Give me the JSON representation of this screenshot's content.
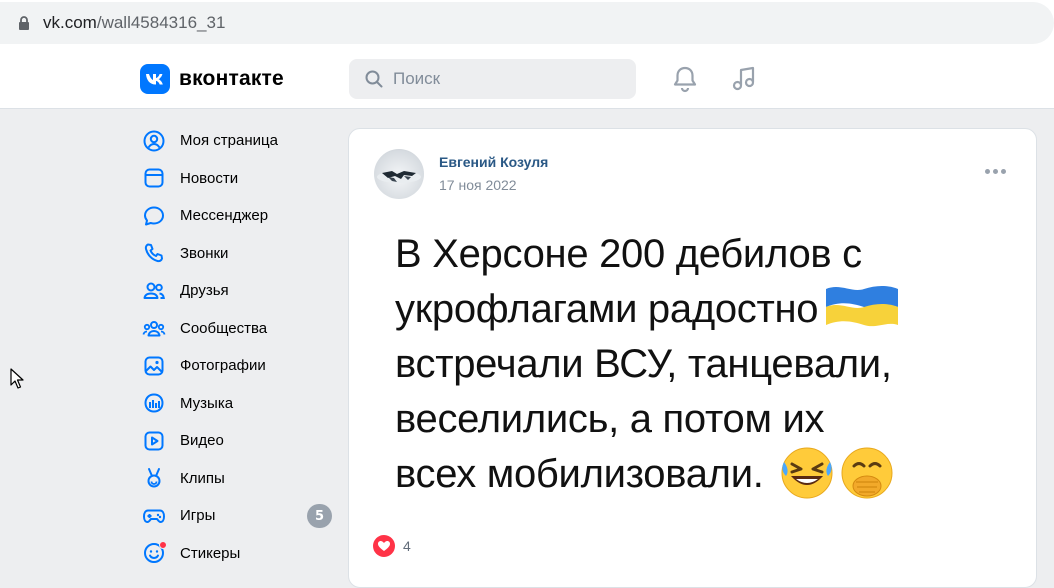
{
  "browser": {
    "url_domain": "vk.com",
    "url_path": "/wall4584316_31"
  },
  "header": {
    "logo_text": "вконтакте",
    "search_placeholder": "Поиск"
  },
  "sidebar": {
    "items": [
      {
        "label": "Моя страница",
        "icon": "user-circle-icon"
      },
      {
        "label": "Новости",
        "icon": "newsfeed-icon"
      },
      {
        "label": "Мессенджер",
        "icon": "message-icon"
      },
      {
        "label": "Звонки",
        "icon": "phone-icon"
      },
      {
        "label": "Друзья",
        "icon": "users-icon"
      },
      {
        "label": "Сообщества",
        "icon": "groups-icon"
      },
      {
        "label": "Фотографии",
        "icon": "photo-icon"
      },
      {
        "label": "Музыка",
        "icon": "music-icon"
      },
      {
        "label": "Видео",
        "icon": "video-icon"
      },
      {
        "label": "Клипы",
        "icon": "clips-icon"
      },
      {
        "label": "Игры",
        "icon": "game-icon",
        "badge": "5"
      },
      {
        "label": "Стикеры",
        "icon": "sticker-icon"
      }
    ]
  },
  "post": {
    "author": "Евгений Козуля",
    "date": "17 ноя 2022",
    "lines": [
      "В Херсоне 200 дебилов с",
      "укрофлагами радостно",
      "встречали ВСУ, танцевали,",
      "веселились, а потом их",
      "всех мобилизовали."
    ],
    "likes": "4"
  },
  "colors": {
    "accent": "#0077ff",
    "link": "#2a5885",
    "badge": "#99a2ad",
    "like": "#ff3347"
  }
}
